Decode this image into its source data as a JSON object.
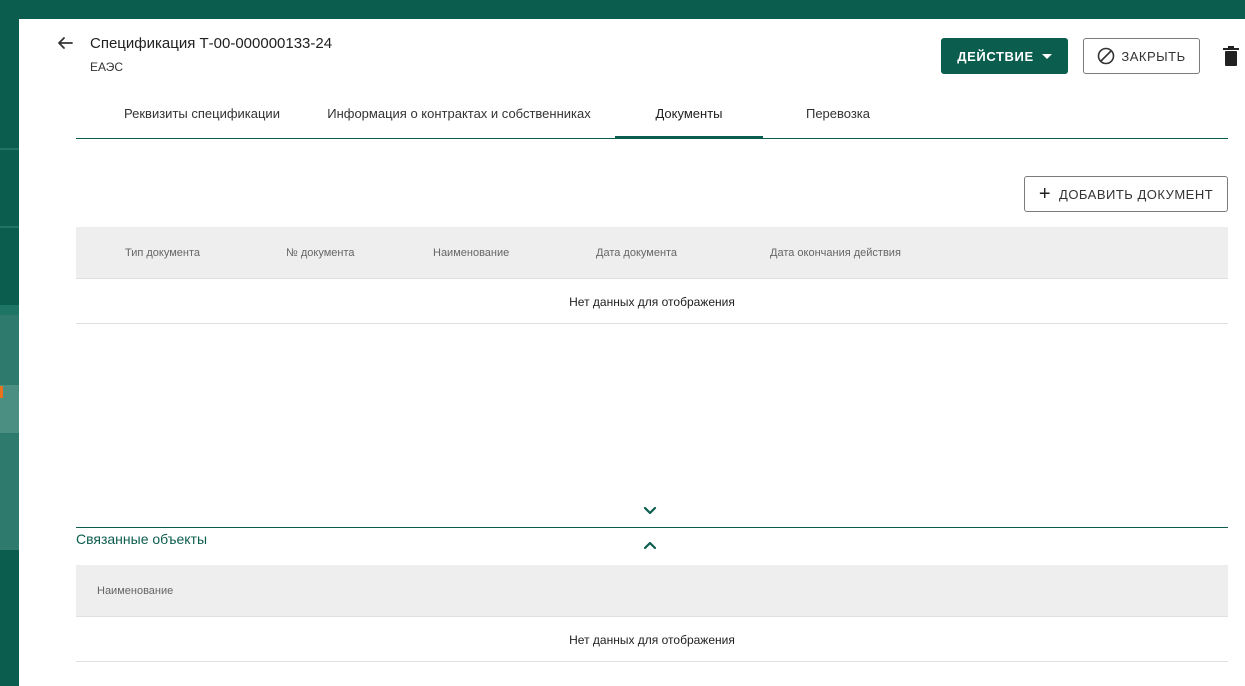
{
  "header": {
    "title": "Спецификация Т-00-000000133-24",
    "subtitle": "ЕАЭС",
    "action_label": "ДЕЙСТВИЕ",
    "close_label": "ЗАКРЫТЬ"
  },
  "tabs": [
    {
      "label": "Реквизиты спецификации"
    },
    {
      "label": "Информация о контрактах и собственниках"
    },
    {
      "label": "Документы",
      "active": true
    },
    {
      "label": "Перевозка"
    }
  ],
  "documents": {
    "add_label": "ДОБАВИТЬ ДОКУМЕНТ",
    "columns": [
      "Тип документа",
      "№ документа",
      "Наименование",
      "Дата документа",
      "Дата окончания действия"
    ],
    "empty_text": "Нет данных для отображения"
  },
  "related": {
    "title": "Связанные объекты",
    "columns": [
      "Наименование"
    ],
    "empty_text": "Нет данных для отображения"
  },
  "colors": {
    "accent": "#0b5d4e",
    "header_bg": "#eeeeee"
  }
}
